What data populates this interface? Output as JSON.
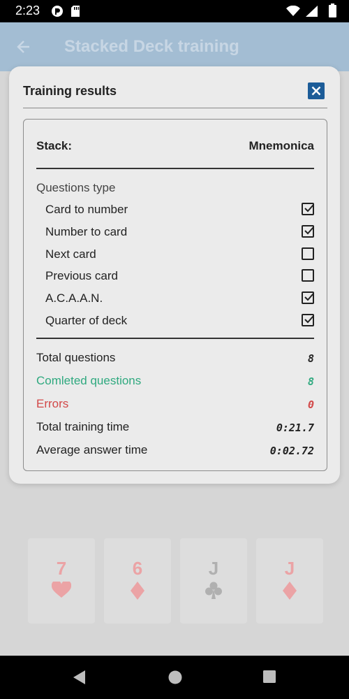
{
  "status_bar": {
    "time": "2:23"
  },
  "app_bar": {
    "title": "Stacked Deck training"
  },
  "cards": [
    {
      "rank": "7",
      "suit": "hearts"
    },
    {
      "rank": "6",
      "suit": "diamonds"
    },
    {
      "rank": "J",
      "suit": "clubs"
    },
    {
      "rank": "J",
      "suit": "diamonds"
    }
  ],
  "dialog": {
    "title": "Training results",
    "stack_label": "Stack:",
    "stack_value": "Mnemonica",
    "questions_type_heading": "Questions type",
    "question_types": [
      {
        "label": "Card to number",
        "checked": true
      },
      {
        "label": "Number to card",
        "checked": true
      },
      {
        "label": "Next card",
        "checked": false
      },
      {
        "label": "Previous card",
        "checked": false
      },
      {
        "label": "A.C.A.A.N.",
        "checked": true
      },
      {
        "label": "Quarter of deck",
        "checked": true
      }
    ],
    "stats": {
      "total_questions_label": "Total questions",
      "total_questions_value": "8",
      "completed_label": "Comleted questions",
      "completed_value": "8",
      "errors_label": "Errors",
      "errors_value": "0",
      "total_time_label": "Total training time",
      "total_time_value": "0:21.7",
      "avg_time_label": "Average answer time",
      "avg_time_value": "0:02.72"
    }
  },
  "colors": {
    "accent": "#1c5c98",
    "completed": "#2fa97f",
    "errors": "#d24848"
  }
}
